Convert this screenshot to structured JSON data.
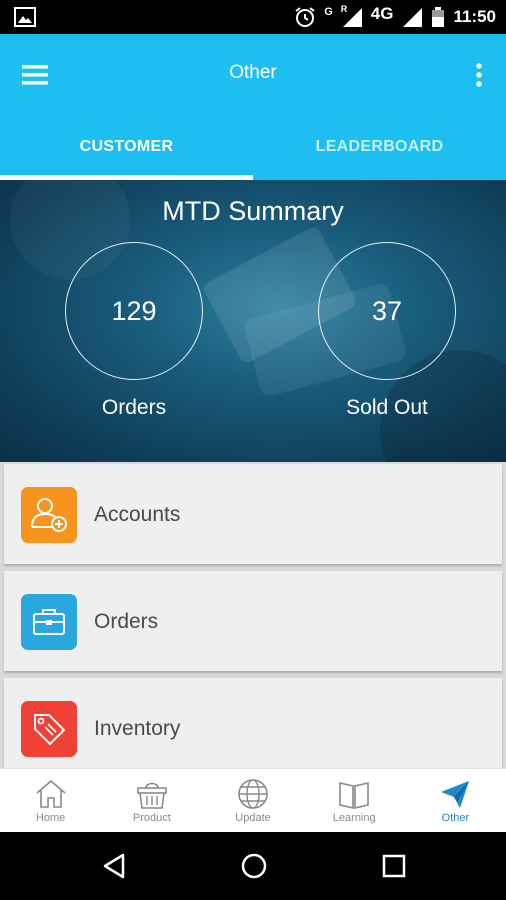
{
  "status_bar": {
    "network_g": "G",
    "roaming_r": "R",
    "network_4g": "4G",
    "time": "11:50",
    "icons": [
      "image-icon",
      "alarm-icon",
      "signal-icon",
      "signal-icon",
      "battery-icon"
    ]
  },
  "app_bar": {
    "title": "Other",
    "menu_icon": "hamburger-menu-icon",
    "more_icon": "more-vertical-icon"
  },
  "tabs": [
    {
      "label": "CUSTOMER",
      "active": true
    },
    {
      "label": "LEADERBOARD",
      "active": false
    }
  ],
  "summary": {
    "title": "MTD Summary",
    "stats": [
      {
        "value": "129",
        "label": "Orders"
      },
      {
        "value": "37",
        "label": "Sold Out"
      }
    ]
  },
  "menu_items": [
    {
      "label": "Accounts",
      "icon": "add-user-icon",
      "color": "#f7941d"
    },
    {
      "label": "Orders",
      "icon": "briefcase-icon",
      "color": "#2aa7df"
    },
    {
      "label": "Inventory",
      "icon": "tag-icon",
      "color": "#ef4136"
    }
  ],
  "bottom_nav": [
    {
      "label": "Home",
      "icon": "home-icon"
    },
    {
      "label": "Product",
      "icon": "basket-icon"
    },
    {
      "label": "Update",
      "icon": "globe-icon"
    },
    {
      "label": "Learning",
      "icon": "book-icon"
    },
    {
      "label": "Other",
      "icon": "paper-plane-icon",
      "active": true
    }
  ],
  "colors": {
    "primary": "#1cbff0",
    "active_nav": "#1e88d0",
    "hero_bg": "#14506d"
  }
}
